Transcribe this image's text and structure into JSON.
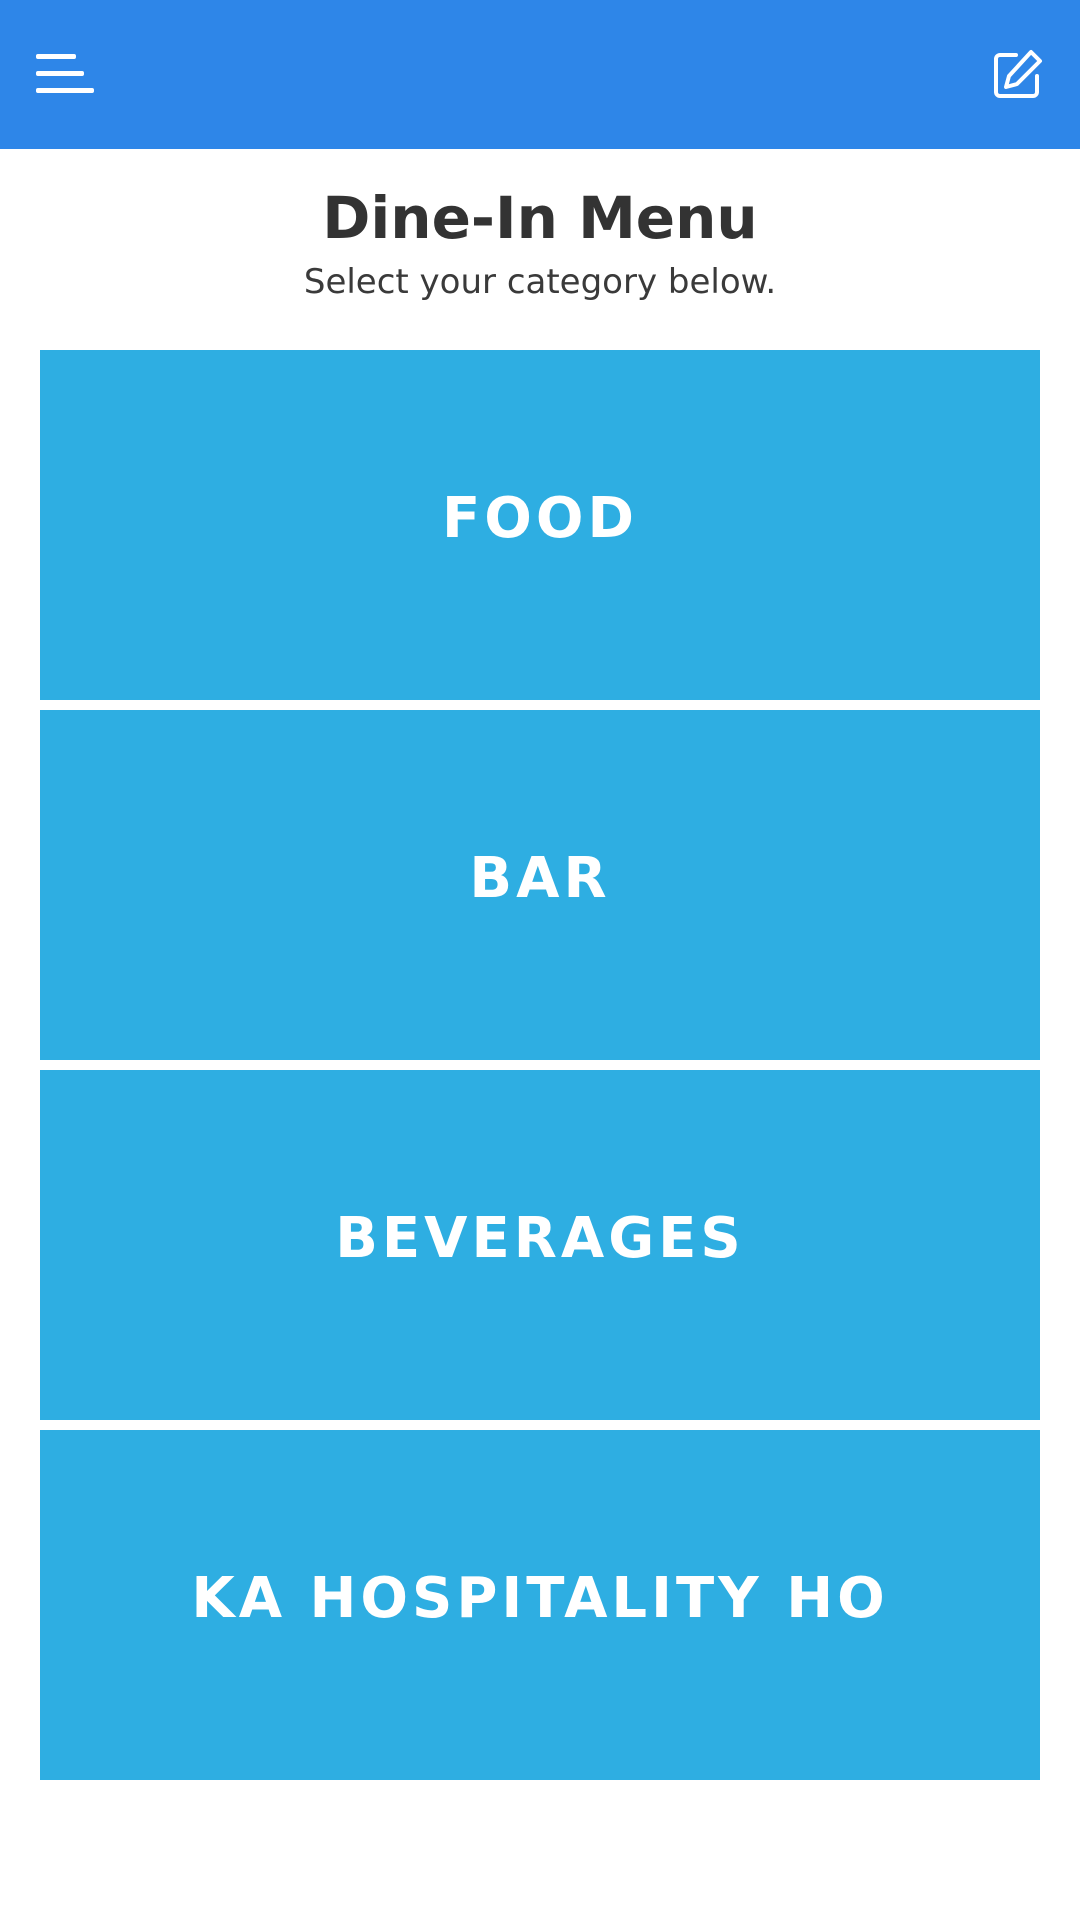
{
  "header": {
    "menu_icon": "hamburger-menu-icon",
    "edit_icon": "edit-pencil-icon",
    "background_color": "#2e86e8"
  },
  "page": {
    "title": "Dine-In Menu",
    "subtitle": "Select your category below."
  },
  "categories": [
    {
      "label": "FOOD"
    },
    {
      "label": "BAR"
    },
    {
      "label": "BEVERAGES"
    },
    {
      "label": "KA HOSPITALITY HO"
    }
  ],
  "colors": {
    "tile_background": "#2eaee2",
    "tile_text": "#ffffff"
  }
}
